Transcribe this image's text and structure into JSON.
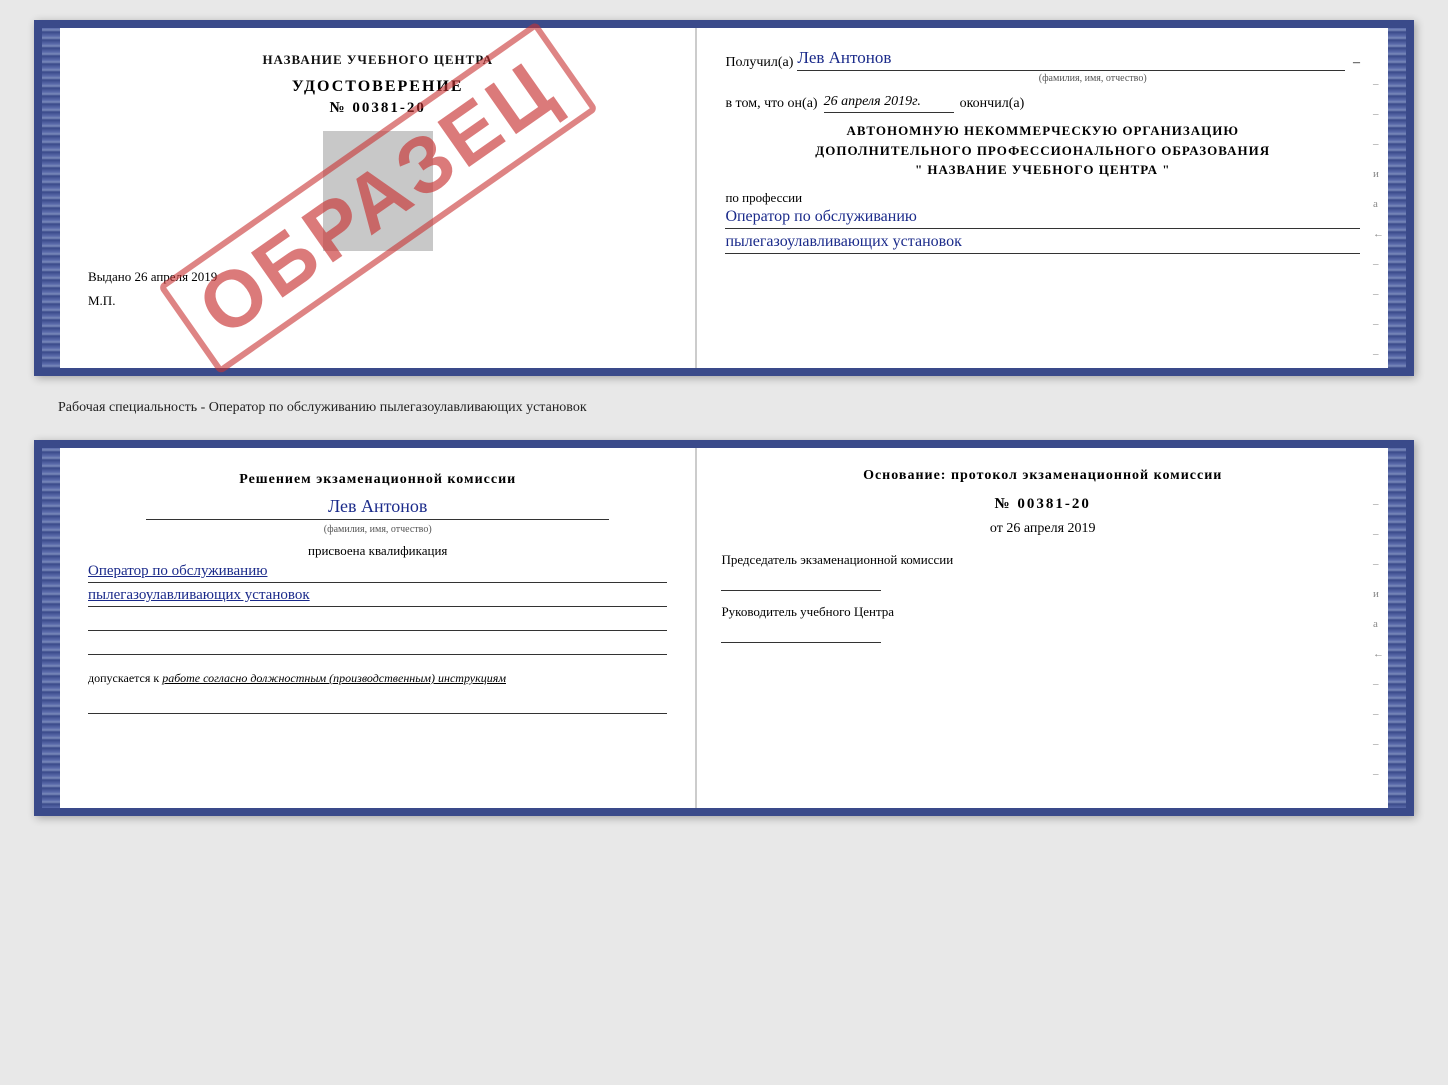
{
  "topDoc": {
    "left": {
      "schoolTitle": "НАЗВАНИЕ УЧЕБНОГО ЦЕНТРА",
      "certLabel": "УДОСТОВЕРЕНИЕ",
      "certNumber": "№ 00381-20",
      "issuedText": "Выдано",
      "issuedDate": "26 апреля 2019",
      "mpLabel": "М.П.",
      "obrazec": "ОБРАЗЕЦ"
    },
    "right": {
      "receivedLabel": "Получил(а)",
      "receivedName": "Лев Антонов",
      "receivedDash": "–",
      "fioHint": "(фамилия, имя, отчество)",
      "datePrefixLabel": "в том, что он(а)",
      "dateValue": "26 апреля 2019г.",
      "dateOkonchilLabel": "окончил(а)",
      "orgLine1": "АВТОНОМНУЮ НЕКОММЕРЧЕСКУЮ ОРГАНИЗАЦИЮ",
      "orgLine2": "ДОПОЛНИТЕЛЬНОГО ПРОФЕССИОНАЛЬНОГО ОБРАЗОВАНИЯ",
      "orgLine3": "\"  НАЗВАНИЕ УЧЕБНОГО ЦЕНТРА  \"",
      "professionLabel": "по профессии",
      "professionLine1": "Оператор по обслуживанию",
      "professionLine2": "пылегазоулавливающих установок",
      "sideMarks": [
        "–",
        "–",
        "–",
        "и",
        "а",
        "←",
        "–",
        "–",
        "–",
        "–"
      ]
    }
  },
  "separator": {
    "text": "Рабочая специальность - Оператор по обслуживанию пылегазоулавливающих установок"
  },
  "bottomDoc": {
    "left": {
      "commissionTitle": "Решением экзаменационной комиссии",
      "personName": "Лев Антонов",
      "fioHint": "(фамилия, имя, отчество)",
      "qualLabel": "присвоена квалификация",
      "qualLine1": "Оператор по обслуживанию",
      "qualLine2": "пылегазоулавливающих установок",
      "emptyLines": [
        "",
        "",
        ""
      ],
      "allowedLabel": "допускается к",
      "allowedValue": "работе согласно должностным (производственным) инструкциям"
    },
    "right": {
      "basisTitle": "Основание: протокол экзаменационной комиссии",
      "protocolNumber": "№  00381-20",
      "protocolDatePrefix": "от",
      "protocolDate": "26 апреля 2019",
      "chairmanLabel": "Председатель экзаменационной комиссии",
      "headLabel": "Руководитель учебного Центра",
      "sideMarks": [
        "–",
        "–",
        "–",
        "и",
        "а",
        "←",
        "–",
        "–",
        "–",
        "–"
      ]
    }
  }
}
